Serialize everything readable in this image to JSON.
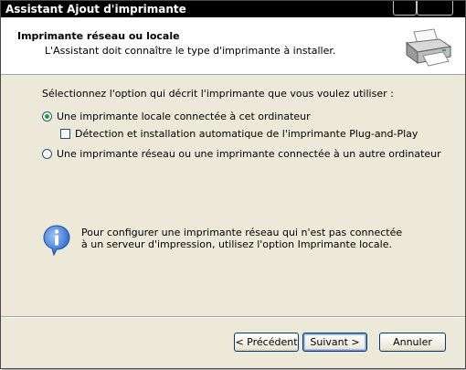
{
  "window": {
    "title": "Assistant Ajout d'imprimante"
  },
  "header": {
    "title": "Imprimante réseau ou locale",
    "subtitle": "L'Assistant doit connaître le type d'imprimante à installer.",
    "icon": "printer-icon"
  },
  "body": {
    "instruction": "Sélectionnez l'option qui décrit l'imprimante que vous voulez utiliser :",
    "options": [
      {
        "label": "Une imprimante locale connectée à cet ordinateur",
        "selected": true
      },
      {
        "label": "Détection et installation automatique de l'imprimante Plug-and-Play",
        "checked": false
      },
      {
        "label": "Une imprimante réseau ou une imprimante connectée à un autre ordinateur",
        "selected": false
      }
    ],
    "info_text": "Pour configurer une imprimante réseau qui n'est pas connectée à un serveur d'impression, utilisez l'option Imprimante locale.",
    "info_icon": "info-icon"
  },
  "buttons": {
    "back": "< Précédent",
    "next": "Suivant >",
    "cancel": "Annuler"
  },
  "colors": {
    "dialog_bg": "#ece9d8",
    "radio_dot": "#21a121",
    "button_border": "#003c74",
    "info_blue": "#2a66c9"
  }
}
